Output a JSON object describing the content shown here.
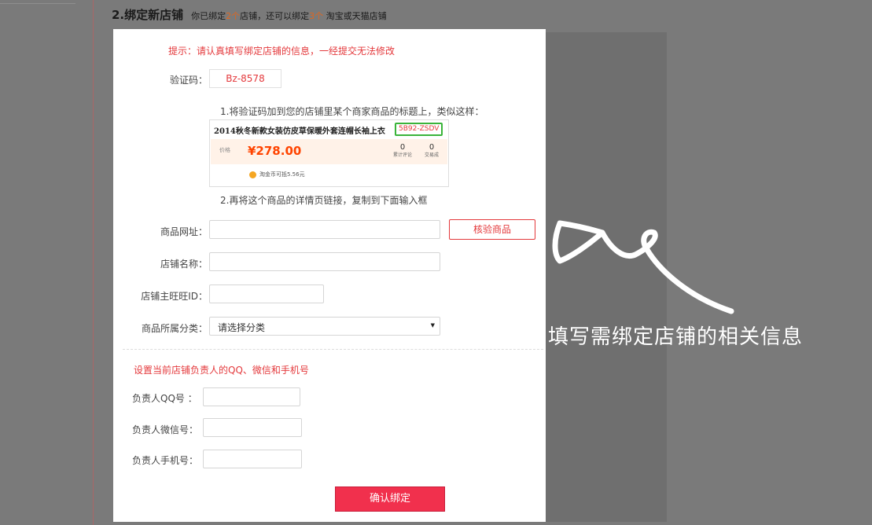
{
  "heading": {
    "title": "2.绑定新店铺",
    "note_prefix": "你已绑定",
    "bound_count": "2个",
    "note_mid": "店铺，还可以绑定",
    "remain_count": "3个",
    "note_suffix": " 淘宝或天猫店铺"
  },
  "form": {
    "warning": "提示：请认真填写绑定店铺的信息，一经提交无法修改",
    "verify_label": "验证码：",
    "verify_code": "Bz-8578",
    "step1": "1.将验证码加到您的店铺里某个商家商品的标题上，类似这样：",
    "sample": {
      "title": "2014秋冬新款女装仿皮草保暖外套连帽长袖上衣",
      "code": "5B92-ZSDV",
      "price_label": "价格",
      "price": "¥278.00",
      "reviews_count": "0",
      "reviews_label": "累计评论",
      "deals_count": "0",
      "deals_label": "交易成",
      "coin_text": "淘金币可抵5.56元"
    },
    "step2": "2.再将这个商品的详情页链接，复制到下面输入框",
    "url_label": "商品网址：",
    "verify_button": "核验商品",
    "shop_label": "店铺名称：",
    "wangwang_label": "店铺主旺旺ID：",
    "category_label": "商品所属分类：",
    "category_value": "请选择分类",
    "contact_title": "设置当前店铺负责人的QQ、微信和手机号",
    "qq_label": "负责人QQ号 ：",
    "wechat_label": "负责人微信号：",
    "phone_label": "负责人手机号：",
    "confirm_button": "确认绑定"
  },
  "annotation": "填写需绑定店铺的相关信息",
  "colors": {
    "accent_red": "#e4393c",
    "confirm_button": "#f1304d",
    "highlight_orange": "#e0661f",
    "code_border_green": "#3ab43a"
  }
}
